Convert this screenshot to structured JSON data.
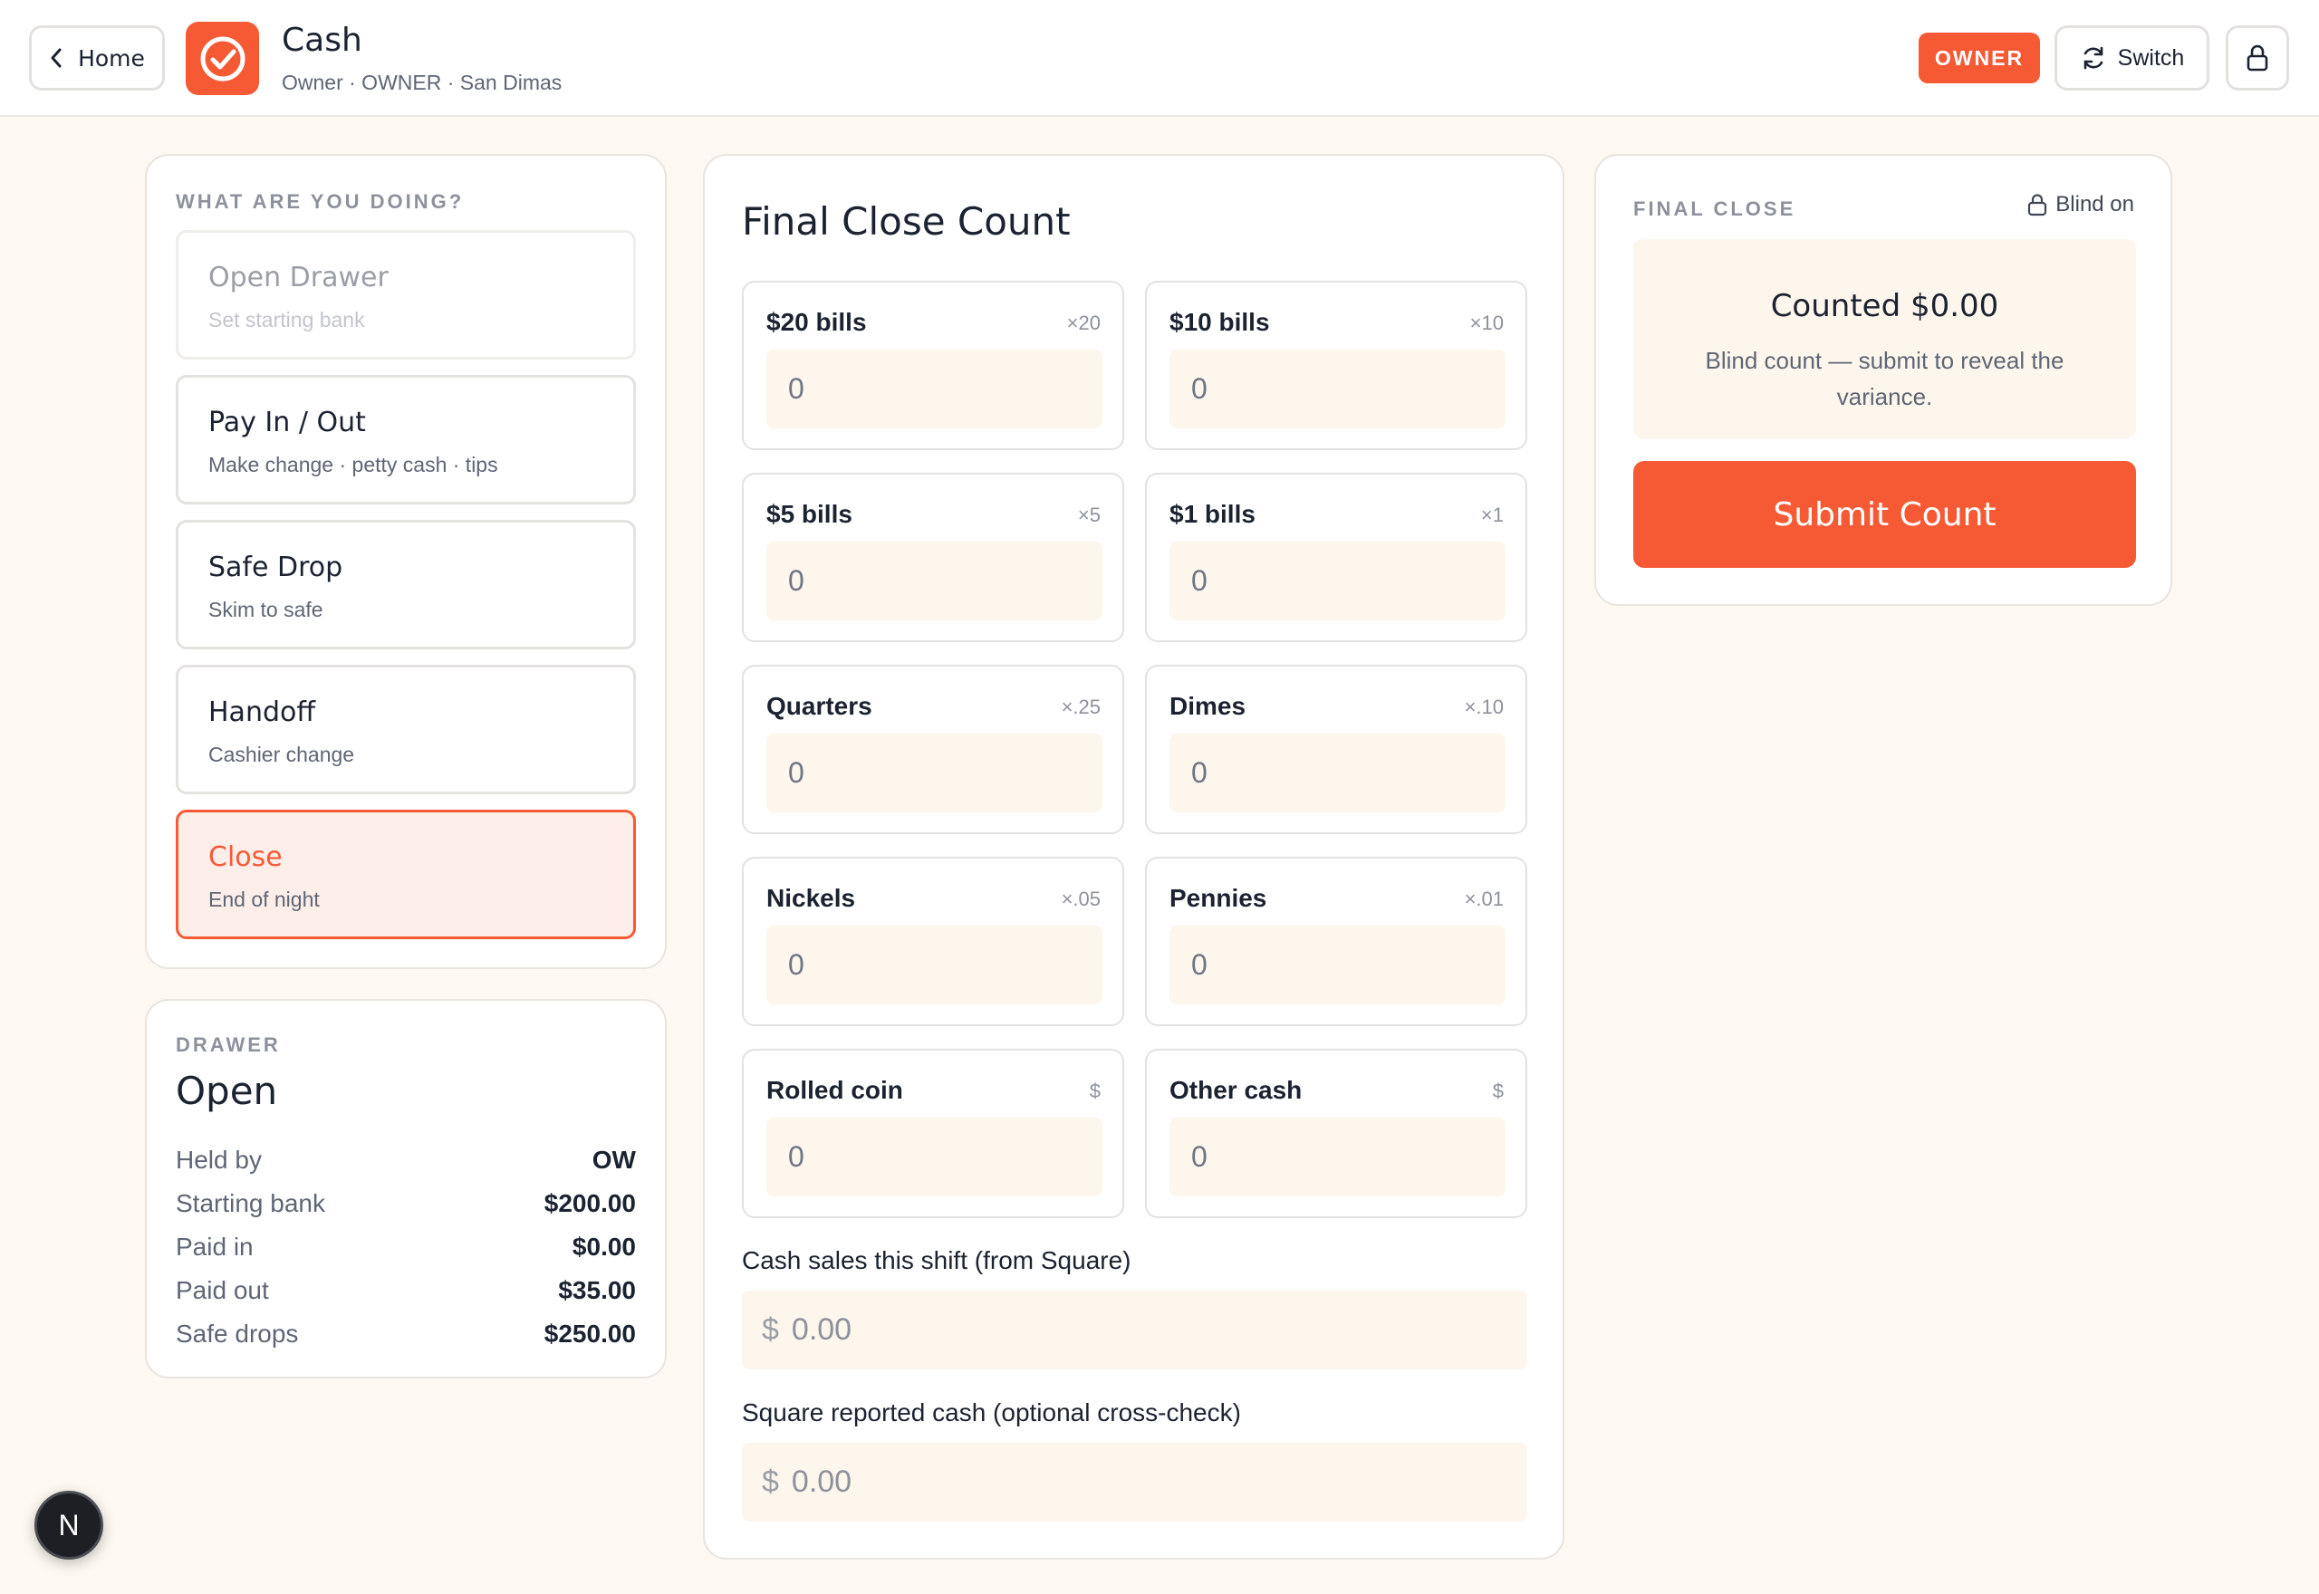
{
  "header": {
    "home_label": "Home",
    "title": "Cash",
    "subtitle": "Owner · OWNER · San Dimas",
    "role_badge": "OWNER",
    "switch_label": "Switch",
    "brand_color": "#f65a35"
  },
  "actions": {
    "heading": "WHAT ARE YOU DOING?",
    "items": [
      {
        "title": "Open Drawer",
        "subtitle": "Set starting bank",
        "state": "disabled"
      },
      {
        "title": "Pay In / Out",
        "subtitle": "Make change · petty cash · tips",
        "state": "default"
      },
      {
        "title": "Safe Drop",
        "subtitle": "Skim to safe",
        "state": "default"
      },
      {
        "title": "Handoff",
        "subtitle": "Cashier change",
        "state": "default"
      },
      {
        "title": "Close",
        "subtitle": "End of night",
        "state": "active"
      }
    ]
  },
  "drawer": {
    "heading": "DRAWER",
    "status": "Open",
    "rows": [
      {
        "label": "Held by",
        "value": "OW"
      },
      {
        "label": "Starting bank",
        "value": "$200.00"
      },
      {
        "label": "Paid in",
        "value": "$0.00"
      },
      {
        "label": "Paid out",
        "value": "$35.00"
      },
      {
        "label": "Safe drops",
        "value": "$250.00"
      }
    ]
  },
  "count": {
    "title": "Final Close Count",
    "denominations": [
      {
        "label": "$20 bills",
        "mult": "×20",
        "value": "0"
      },
      {
        "label": "$10 bills",
        "mult": "×10",
        "value": "0"
      },
      {
        "label": "$5 bills",
        "mult": "×5",
        "value": "0"
      },
      {
        "label": "$1 bills",
        "mult": "×1",
        "value": "0"
      },
      {
        "label": "Quarters",
        "mult": "×.25",
        "value": "0"
      },
      {
        "label": "Dimes",
        "mult": "×.10",
        "value": "0"
      },
      {
        "label": "Nickels",
        "mult": "×.05",
        "value": "0"
      },
      {
        "label": "Pennies",
        "mult": "×.01",
        "value": "0"
      },
      {
        "label": "Rolled coin",
        "mult": "$",
        "value": "0"
      },
      {
        "label": "Other cash",
        "mult": "$",
        "value": "0"
      }
    ],
    "cash_sales": {
      "label": "Cash sales this shift (from Square)",
      "currency": "$",
      "placeholder": "0.00"
    },
    "square_cash": {
      "label": "Square reported cash (optional cross-check)",
      "currency": "$",
      "placeholder": "0.00"
    }
  },
  "summary": {
    "heading": "FINAL CLOSE",
    "blind_label": "Blind on",
    "counted": "Counted $0.00",
    "note": "Blind count — submit to reveal the variance.",
    "submit_label": "Submit Count"
  },
  "dev_badge": "N"
}
